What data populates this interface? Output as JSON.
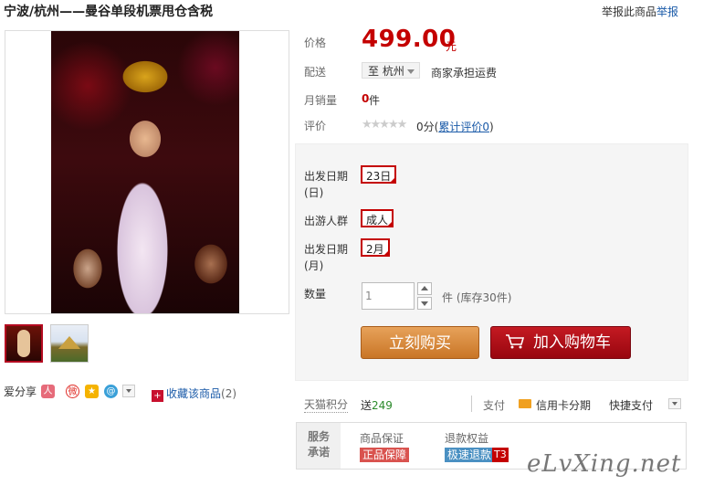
{
  "product": {
    "title": "宁波/杭州——曼谷单段机票甩仓含税"
  },
  "report": {
    "text": "举报此商品",
    "link": "举报"
  },
  "price": {
    "label": "价格",
    "value": "499.00",
    "unit": "元"
  },
  "shipping": {
    "label": "配送",
    "destination": "至 杭州",
    "note": "商家承担运费"
  },
  "sales": {
    "label": "月销量",
    "count": "0",
    "unit": "件"
  },
  "review": {
    "label": "评价",
    "stars": "★★★★★",
    "score": "0分",
    "open": "(",
    "link": "累计评价0",
    "close": ")"
  },
  "options": {
    "date_day": {
      "label_l1": "出发日期",
      "label_l2": "(日)",
      "value": "23日"
    },
    "crowd": {
      "label": "出游人群",
      "value": "成人"
    },
    "date_month": {
      "label_l1": "出发日期",
      "label_l2": "(月)",
      "value": "2月"
    }
  },
  "quantity": {
    "label": "数量",
    "value": "1",
    "stock": "件 (库存30件)"
  },
  "buttons": {
    "buy": "立刻购买",
    "cart": "加入购物车"
  },
  "points": {
    "label": "天猫积分",
    "prefix": "送",
    "value": "249"
  },
  "payment": {
    "label": "支付",
    "card": "信用卡分期",
    "fast": "快捷支付"
  },
  "service": {
    "head_l1": "服务",
    "head_l2": "承诺",
    "guarantee_label": "商品保证",
    "guarantee_tag": "正品保障",
    "refund_label": "退款权益",
    "refund_tag": "极速退款",
    "refund_badge": "T3"
  },
  "share": {
    "label": "爱分享"
  },
  "favorite": {
    "label": "收藏该商品",
    "count": "(2)"
  },
  "watermark": "eLvXing.net",
  "colors": {
    "price_red": "#c40000",
    "buy_orange": "#c97526",
    "cart_red": "#98060f"
  }
}
